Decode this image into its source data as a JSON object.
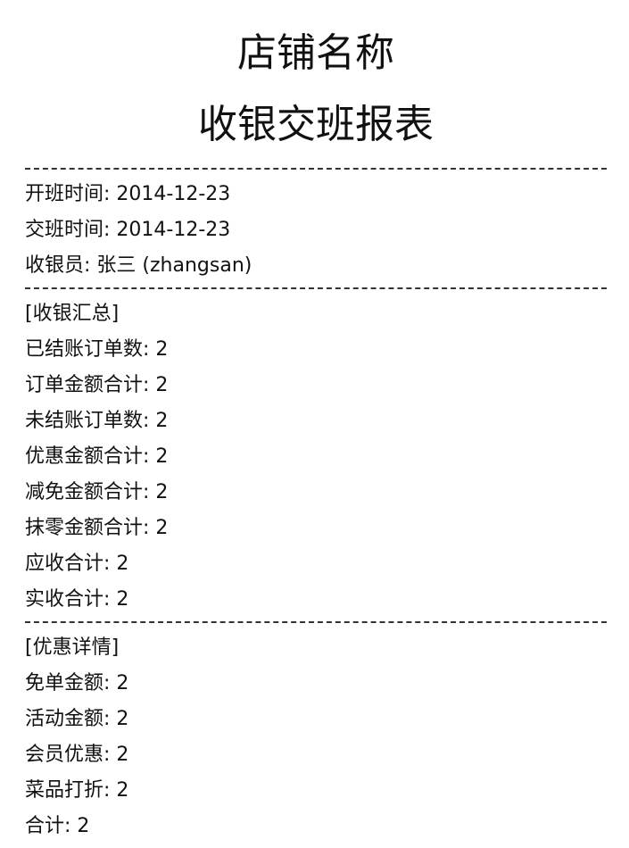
{
  "header": {
    "store_name": "店铺名称",
    "report_title": "收银交班报表"
  },
  "shift": [
    {
      "label": "开班时间:",
      "value": "2014-12-23"
    },
    {
      "label": "交班时间:",
      "value": "2014-12-23"
    },
    {
      "label": "收银员:",
      "value": "张三 (zhangsan)"
    }
  ],
  "summary": {
    "heading": "[收银汇总]",
    "rows": [
      {
        "label": "已结账订单数:",
        "value": "2"
      },
      {
        "label": "订单金额合计:",
        "value": "2"
      },
      {
        "label": "未结账订单数:",
        "value": "2"
      },
      {
        "label": "优惠金额合计:",
        "value": "2"
      },
      {
        "label": "减免金额合计:",
        "value": "2"
      },
      {
        "label": "抹零金额合计:",
        "value": "2"
      },
      {
        "label": "应收合计:",
        "value": "2"
      },
      {
        "label": "实收合计:",
        "value": "2"
      }
    ]
  },
  "discount": {
    "heading": "[优惠详情]",
    "rows": [
      {
        "label": "免单金额:",
        "value": "2"
      },
      {
        "label": "活动金额:",
        "value": "2"
      },
      {
        "label": "会员优惠:",
        "value": "2"
      },
      {
        "label": "菜品打折:",
        "value": "2"
      },
      {
        "label": "合计:",
        "value": "2"
      }
    ]
  }
}
